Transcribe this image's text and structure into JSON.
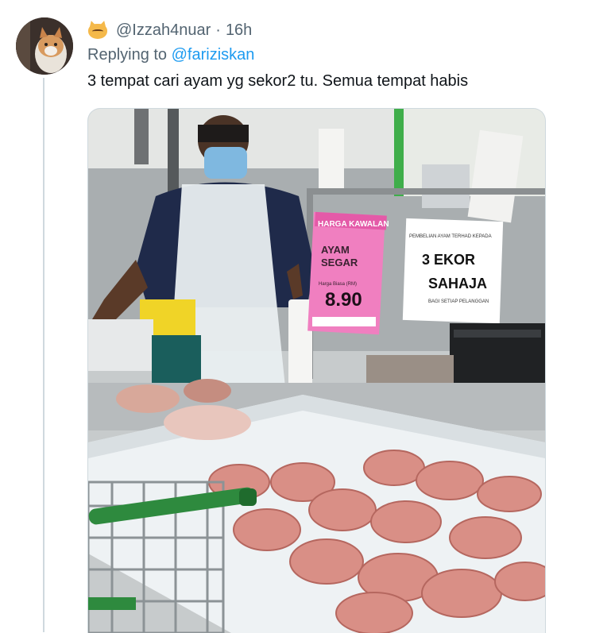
{
  "tweet": {
    "author_handle": "@Izzah4nuar",
    "separator": "·",
    "timestamp": "16h",
    "replying_prefix": "Replying to ",
    "replying_to": "@fariziskan",
    "text": "3 tempat cari ayam yg sekor2 tu. Semua tempat habis",
    "emoji": "cat-face-icon",
    "colors": {
      "accent": "#1d9bf0",
      "secondary_text": "#536471",
      "primary_text": "#0f1419"
    }
  },
  "photo": {
    "price_sign": {
      "header": "HARGA KAWALAN",
      "line1": "AYAM",
      "line2": "SEGAR",
      "small_label": "Harga Biasa (RM)",
      "price": "8.90",
      "color": "#f07fc0"
    },
    "limit_sign": {
      "small_top": "PEMBELIAN AYAM TERHAD KEPADA",
      "line1": "3 EKOR",
      "line2": "SAHAJA",
      "small_bottom": "BAGI SETIAP PELANGGAN"
    }
  }
}
